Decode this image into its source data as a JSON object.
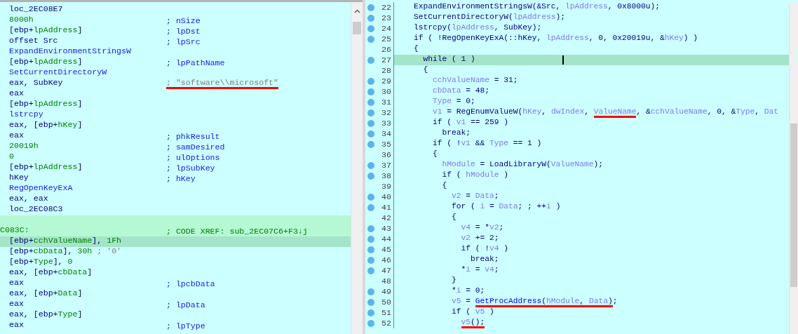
{
  "disassembly": {
    "lines": [
      {
        "kind": "instr",
        "selected": false,
        "code": [
          {
            "text": "loc_2EC08E7",
            "kind": "op"
          }
        ]
      },
      {
        "kind": "instr",
        "selected": false,
        "code": [
          {
            "text": "8000h",
            "kind": "num"
          }
        ],
        "comment": {
          "text": "; nSize",
          "kind": "arg"
        }
      },
      {
        "kind": "instr",
        "selected": false,
        "code": [
          {
            "text": "[ebp+",
            "kind": "op"
          },
          {
            "text": "lpAddress",
            "kind": "var"
          },
          {
            "text": "]",
            "kind": "op"
          }
        ],
        "comment": {
          "text": "; lpDst",
          "kind": "arg"
        }
      },
      {
        "kind": "instr",
        "selected": false,
        "code": [
          {
            "text": "offset Src",
            "kind": "op"
          }
        ],
        "comment": {
          "text": "; lpSrc",
          "kind": "arg"
        }
      },
      {
        "kind": "instr",
        "selected": false,
        "code": [
          {
            "text": "ExpandEnvironmentStringsW",
            "kind": "func"
          }
        ]
      },
      {
        "kind": "instr",
        "selected": false,
        "code": [
          {
            "text": "[ebp+",
            "kind": "op"
          },
          {
            "text": "lpAddress",
            "kind": "var"
          },
          {
            "text": "]",
            "kind": "op"
          }
        ],
        "comment": {
          "text": "; lpPathName",
          "kind": "arg"
        }
      },
      {
        "kind": "instr",
        "selected": false,
        "code": [
          {
            "text": "SetCurrentDirectoryW",
            "kind": "func"
          }
        ]
      },
      {
        "kind": "instr",
        "selected": false,
        "code": [
          {
            "text": "eax, SubKey",
            "kind": "op"
          }
        ],
        "comment": {
          "text": "; \"software\\\\microsoft\"",
          "kind": "str",
          "underlined": true
        }
      },
      {
        "kind": "instr",
        "selected": false,
        "code": [
          {
            "text": "eax",
            "kind": "op"
          }
        ]
      },
      {
        "kind": "instr",
        "selected": false,
        "code": [
          {
            "text": "[ebp+",
            "kind": "op"
          },
          {
            "text": "lpAddress",
            "kind": "var"
          },
          {
            "text": "]",
            "kind": "op"
          }
        ]
      },
      {
        "kind": "instr",
        "selected": false,
        "code": [
          {
            "text": "lstrcpy",
            "kind": "func"
          }
        ]
      },
      {
        "kind": "instr",
        "selected": false,
        "code": [
          {
            "text": "eax, [ebp+",
            "kind": "op"
          },
          {
            "text": "hKey",
            "kind": "var"
          },
          {
            "text": "]",
            "kind": "op"
          }
        ]
      },
      {
        "kind": "instr",
        "selected": false,
        "code": [
          {
            "text": "eax",
            "kind": "op"
          }
        ],
        "comment": {
          "text": "; phkResult",
          "kind": "arg"
        }
      },
      {
        "kind": "instr",
        "selected": false,
        "code": [
          {
            "text": "20019h",
            "kind": "num"
          }
        ],
        "comment": {
          "text": "; samDesired",
          "kind": "arg"
        }
      },
      {
        "kind": "instr",
        "selected": false,
        "code": [
          {
            "text": "0",
            "kind": "num"
          }
        ],
        "comment": {
          "text": "; ulOptions",
          "kind": "arg"
        }
      },
      {
        "kind": "instr",
        "selected": false,
        "code": [
          {
            "text": "[ebp+",
            "kind": "op"
          },
          {
            "text": "lpAddress",
            "kind": "var"
          },
          {
            "text": "]",
            "kind": "op"
          }
        ],
        "comment": {
          "text": "; lpSubKey",
          "kind": "arg"
        }
      },
      {
        "kind": "instr",
        "selected": false,
        "code": [
          {
            "text": "hKey",
            "kind": "op"
          }
        ],
        "comment": {
          "text": "; hKey",
          "kind": "arg"
        }
      },
      {
        "kind": "instr",
        "selected": false,
        "code": [
          {
            "text": "RegOpenKeyExA",
            "kind": "func"
          }
        ]
      },
      {
        "kind": "instr",
        "selected": false,
        "code": [
          {
            "text": "eax, eax",
            "kind": "op"
          }
        ]
      },
      {
        "kind": "instr",
        "selected": false,
        "code": [
          {
            "text": "loc_2EC08C3",
            "kind": "op"
          }
        ]
      },
      {
        "kind": "blank",
        "selected": false
      },
      {
        "kind": "label",
        "selected": false,
        "code": [
          {
            "text": "C083C:",
            "kind": "num"
          }
        ],
        "comment": {
          "text": "; CODE XREF: sub_2EC07C6+F3↓j",
          "kind": "xref"
        }
      },
      {
        "kind": "instr",
        "selected": true,
        "code": [
          {
            "text": "[ebp+",
            "kind": "op"
          },
          {
            "text": "cchValueName",
            "kind": "var"
          },
          {
            "text": "], ",
            "kind": "op"
          },
          {
            "text": "1Fh",
            "kind": "num"
          }
        ]
      },
      {
        "kind": "instr",
        "selected": false,
        "code": [
          {
            "text": "[ebp+",
            "kind": "op"
          },
          {
            "text": "cbData",
            "kind": "var"
          },
          {
            "text": "], ",
            "kind": "op"
          },
          {
            "text": "30h",
            "kind": "num"
          },
          {
            "text": " ; '0'",
            "kind": "str"
          }
        ]
      },
      {
        "kind": "instr",
        "selected": false,
        "code": [
          {
            "text": "[ebp+",
            "kind": "op"
          },
          {
            "text": "Type",
            "kind": "var"
          },
          {
            "text": "], ",
            "kind": "op"
          },
          {
            "text": "0",
            "kind": "num"
          }
        ]
      },
      {
        "kind": "instr",
        "selected": false,
        "code": [
          {
            "text": "eax, [ebp+",
            "kind": "op"
          },
          {
            "text": "cbData",
            "kind": "var"
          },
          {
            "text": "]",
            "kind": "op"
          }
        ]
      },
      {
        "kind": "instr",
        "selected": false,
        "code": [
          {
            "text": "eax",
            "kind": "op"
          }
        ],
        "comment": {
          "text": "; lpcbData",
          "kind": "arg"
        }
      },
      {
        "kind": "instr",
        "selected": false,
        "code": [
          {
            "text": "eax, [ebp+",
            "kind": "op"
          },
          {
            "text": "Data",
            "kind": "var"
          },
          {
            "text": "]",
            "kind": "op"
          }
        ]
      },
      {
        "kind": "instr",
        "selected": false,
        "code": [
          {
            "text": "eax",
            "kind": "op"
          }
        ],
        "comment": {
          "text": "; lpData",
          "kind": "arg"
        }
      },
      {
        "kind": "instr",
        "selected": false,
        "code": [
          {
            "text": "eax, [ebp+",
            "kind": "op"
          },
          {
            "text": "Type",
            "kind": "var"
          },
          {
            "text": "]",
            "kind": "op"
          }
        ]
      },
      {
        "kind": "instr",
        "selected": false,
        "code": [
          {
            "text": "eax",
            "kind": "op"
          }
        ],
        "comment": {
          "text": "; lpType",
          "kind": "arg"
        }
      }
    ]
  },
  "pseudocode": {
    "lines": [
      {
        "number": "22",
        "marker": true,
        "current": false,
        "code": [
          {
            "text": "ExpandEnvironmentStringsW",
            "kind": "func"
          },
          {
            "text": "(&Src, ",
            "kind": "op"
          },
          {
            "text": "lpAddress",
            "kind": "var"
          },
          {
            "text": ", 0x8000u);",
            "kind": "op"
          }
        ]
      },
      {
        "number": "23",
        "marker": true,
        "current": false,
        "code": [
          {
            "text": "SetCurrentDirectoryW",
            "kind": "func"
          },
          {
            "text": "(",
            "kind": "op"
          },
          {
            "text": "lpAddress",
            "kind": "var"
          },
          {
            "text": ");",
            "kind": "op"
          }
        ]
      },
      {
        "number": "24",
        "marker": true,
        "current": false,
        "code": [
          {
            "text": "lstrcpy",
            "kind": "func"
          },
          {
            "text": "(",
            "kind": "op"
          },
          {
            "text": "lpAddress",
            "kind": "var"
          },
          {
            "text": ", SubKey);",
            "kind": "op"
          }
        ]
      },
      {
        "number": "25",
        "marker": true,
        "current": false,
        "code": [
          {
            "text": "if ( !",
            "kind": "op"
          },
          {
            "text": "RegOpenKeyExA",
            "kind": "func"
          },
          {
            "text": "(::hKey, ",
            "kind": "op"
          },
          {
            "text": "lpAddress",
            "kind": "var"
          },
          {
            "text": ", 0, 0x20019u, &",
            "kind": "op"
          },
          {
            "text": "hKey",
            "kind": "var"
          },
          {
            "text": ") )",
            "kind": "op"
          }
        ]
      },
      {
        "number": "26",
        "marker": false,
        "current": false,
        "code": [
          {
            "text": "{",
            "kind": "op"
          }
        ]
      },
      {
        "number": "27",
        "marker": true,
        "current": true,
        "code": [
          {
            "text": "  while ( 1 )",
            "kind": "op"
          }
        ]
      },
      {
        "number": "28",
        "marker": false,
        "current": false,
        "code": [
          {
            "text": "  {",
            "kind": "op"
          }
        ]
      },
      {
        "number": "29",
        "marker": true,
        "current": false,
        "code": [
          {
            "text": "    cchValueName",
            "kind": "var"
          },
          {
            "text": " = 31;",
            "kind": "op"
          }
        ]
      },
      {
        "number": "30",
        "marker": true,
        "current": false,
        "code": [
          {
            "text": "    cbData",
            "kind": "var"
          },
          {
            "text": " = 48;",
            "kind": "op"
          }
        ]
      },
      {
        "number": "31",
        "marker": true,
        "current": false,
        "code": [
          {
            "text": "    Type",
            "kind": "var"
          },
          {
            "text": " = 0;",
            "kind": "op"
          }
        ]
      },
      {
        "number": "32",
        "marker": true,
        "current": false,
        "code": [
          {
            "text": "    v1",
            "kind": "var"
          },
          {
            "text": " = ",
            "kind": "op"
          },
          {
            "text": "RegEnumValueW",
            "kind": "func"
          },
          {
            "text": "(",
            "kind": "op"
          },
          {
            "text": "hKey",
            "kind": "var"
          },
          {
            "text": ", ",
            "kind": "op"
          },
          {
            "text": "dwIndex",
            "kind": "var"
          },
          {
            "text": ", ",
            "kind": "op"
          },
          {
            "text": "ValueName",
            "kind": "var",
            "underlined": true
          },
          {
            "text": ", &",
            "kind": "op"
          },
          {
            "text": "cchValueName",
            "kind": "var"
          },
          {
            "text": ", 0, &",
            "kind": "op"
          },
          {
            "text": "Type",
            "kind": "var"
          },
          {
            "text": ", ",
            "kind": "op"
          },
          {
            "text": "Dat",
            "kind": "var"
          }
        ]
      },
      {
        "number": "33",
        "marker": true,
        "current": false,
        "code": [
          {
            "text": "    if ( ",
            "kind": "op"
          },
          {
            "text": "v1",
            "kind": "var"
          },
          {
            "text": " == 259 )",
            "kind": "op"
          }
        ]
      },
      {
        "number": "34",
        "marker": true,
        "current": false,
        "code": [
          {
            "text": "      break;",
            "kind": "op"
          }
        ]
      },
      {
        "number": "35",
        "marker": true,
        "current": false,
        "code": [
          {
            "text": "    if ( !",
            "kind": "op"
          },
          {
            "text": "v1",
            "kind": "var"
          },
          {
            "text": " && ",
            "kind": "op"
          },
          {
            "text": "Type",
            "kind": "var"
          },
          {
            "text": " == 1 )",
            "kind": "op"
          }
        ]
      },
      {
        "number": "36",
        "marker": false,
        "current": false,
        "code": [
          {
            "text": "    {",
            "kind": "op"
          }
        ]
      },
      {
        "number": "37",
        "marker": true,
        "current": false,
        "code": [
          {
            "text": "      hModule",
            "kind": "var"
          },
          {
            "text": " = ",
            "kind": "op"
          },
          {
            "text": "LoadLibraryW",
            "kind": "func"
          },
          {
            "text": "(",
            "kind": "op"
          },
          {
            "text": "ValueName",
            "kind": "var"
          },
          {
            "text": ");",
            "kind": "op"
          }
        ]
      },
      {
        "number": "38",
        "marker": true,
        "current": false,
        "code": [
          {
            "text": "      if ( ",
            "kind": "op"
          },
          {
            "text": "hModule",
            "kind": "var"
          },
          {
            "text": " )",
            "kind": "op"
          }
        ]
      },
      {
        "number": "39",
        "marker": false,
        "current": false,
        "code": [
          {
            "text": "      {",
            "kind": "op"
          }
        ]
      },
      {
        "number": "40",
        "marker": true,
        "current": false,
        "code": [
          {
            "text": "        v2",
            "kind": "var"
          },
          {
            "text": " = ",
            "kind": "op"
          },
          {
            "text": "Data",
            "kind": "var"
          },
          {
            "text": ";",
            "kind": "op"
          }
        ]
      },
      {
        "number": "41",
        "marker": true,
        "current": false,
        "code": [
          {
            "text": "        for ( ",
            "kind": "op"
          },
          {
            "text": "i",
            "kind": "var"
          },
          {
            "text": " = ",
            "kind": "op"
          },
          {
            "text": "Data",
            "kind": "var"
          },
          {
            "text": "; ; ++",
            "kind": "op"
          },
          {
            "text": "i",
            "kind": "var"
          },
          {
            "text": " )",
            "kind": "op"
          }
        ]
      },
      {
        "number": "42",
        "marker": false,
        "current": false,
        "code": [
          {
            "text": "        {",
            "kind": "op"
          }
        ]
      },
      {
        "number": "43",
        "marker": true,
        "current": false,
        "code": [
          {
            "text": "          v4",
            "kind": "var"
          },
          {
            "text": " = *",
            "kind": "op"
          },
          {
            "text": "v2",
            "kind": "var"
          },
          {
            "text": ";",
            "kind": "op"
          }
        ]
      },
      {
        "number": "44",
        "marker": true,
        "current": false,
        "code": [
          {
            "text": "          v2",
            "kind": "var"
          },
          {
            "text": " += 2;",
            "kind": "op"
          }
        ]
      },
      {
        "number": "45",
        "marker": true,
        "current": false,
        "code": [
          {
            "text": "          if ( !",
            "kind": "op"
          },
          {
            "text": "v4",
            "kind": "var"
          },
          {
            "text": " )",
            "kind": "op"
          }
        ]
      },
      {
        "number": "46",
        "marker": true,
        "current": false,
        "code": [
          {
            "text": "            break;",
            "kind": "op"
          }
        ]
      },
      {
        "number": "47",
        "marker": true,
        "current": false,
        "code": [
          {
            "text": "          *",
            "kind": "op"
          },
          {
            "text": "i",
            "kind": "var"
          },
          {
            "text": " = ",
            "kind": "op"
          },
          {
            "text": "v4",
            "kind": "var"
          },
          {
            "text": ";",
            "kind": "op"
          }
        ]
      },
      {
        "number": "48",
        "marker": false,
        "current": false,
        "code": [
          {
            "text": "        }",
            "kind": "op"
          }
        ]
      },
      {
        "number": "49",
        "marker": true,
        "current": false,
        "code": [
          {
            "text": "        *",
            "kind": "op"
          },
          {
            "text": "i",
            "kind": "var"
          },
          {
            "text": " = 0;",
            "kind": "op"
          }
        ]
      },
      {
        "number": "50",
        "marker": true,
        "current": false,
        "code": [
          {
            "text": "        v5",
            "kind": "var"
          },
          {
            "text": " = ",
            "kind": "op"
          },
          {
            "text": "GetProcAddress",
            "kind": "call",
            "underlined": true
          },
          {
            "text": "(",
            "kind": "op",
            "underlined": true
          },
          {
            "text": "hModule",
            "kind": "var",
            "underlined": true
          },
          {
            "text": ", ",
            "kind": "op",
            "underlined": true
          },
          {
            "text": "Data",
            "kind": "var",
            "underlined": true
          },
          {
            "text": ")",
            "kind": "op",
            "underlined": true
          },
          {
            "text": ";",
            "kind": "op"
          }
        ]
      },
      {
        "number": "51",
        "marker": true,
        "current": false,
        "code": [
          {
            "text": "        if ( ",
            "kind": "op"
          },
          {
            "text": "v5",
            "kind": "var"
          },
          {
            "text": " )",
            "kind": "op"
          }
        ]
      },
      {
        "number": "52",
        "marker": true,
        "current": false,
        "code": [
          {
            "text": "          v5",
            "kind": "var",
            "underlined": true
          },
          {
            "text": "();",
            "kind": "op",
            "underlined": true
          }
        ]
      }
    ]
  }
}
